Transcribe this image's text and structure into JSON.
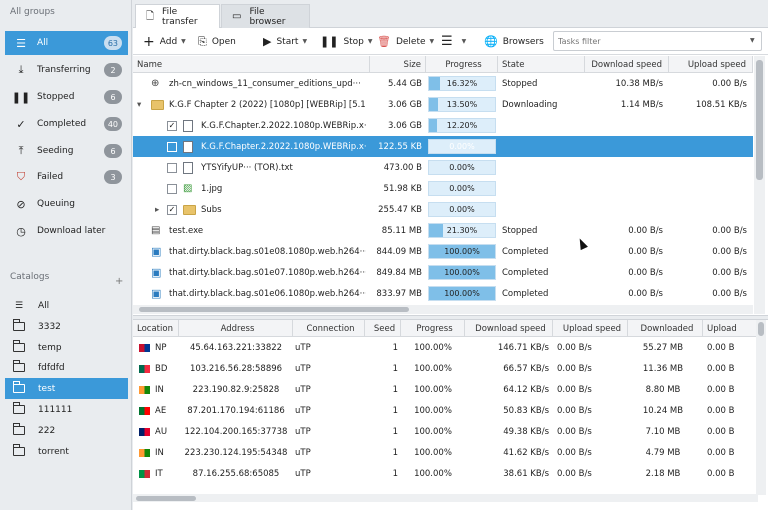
{
  "sidebar": {
    "groups_header": "All groups",
    "groups": [
      {
        "label": "All",
        "count": "63",
        "icon": "menu-lines-icon"
      },
      {
        "label": "Transferring",
        "count": "2",
        "icon": "download-arrow-icon"
      },
      {
        "label": "Stopped",
        "count": "6",
        "icon": "pause-icon"
      },
      {
        "label": "Completed",
        "count": "40",
        "icon": "checkmark-icon"
      },
      {
        "label": "Seeding",
        "count": "6",
        "icon": "upload-tray-icon"
      },
      {
        "label": "Failed",
        "count": "3",
        "icon": "shield-alert-icon"
      },
      {
        "label": "Queuing",
        "count": "",
        "icon": "compass-icon"
      },
      {
        "label": "Download later",
        "count": "",
        "icon": "clock-icon"
      }
    ],
    "catalogs_header": "Catalogs",
    "catalogs": [
      "All",
      "3332",
      "temp",
      "fdfdfd",
      "test",
      "111111",
      "222",
      "torrent"
    ]
  },
  "tabs": [
    "File transfer",
    "File browser"
  ],
  "toolbar": {
    "add": "Add",
    "open": "Open",
    "start": "Start",
    "stop": "Stop",
    "delete": "Delete",
    "browsers": "Browsers",
    "search_placeholder": "Tasks filter"
  },
  "files": {
    "columns": [
      "Name",
      "Size",
      "Progress",
      "State",
      "Download speed",
      "Upload speed"
    ],
    "rows": [
      {
        "name": "zh-cn_windows_11_consumer_editions_upd···",
        "size": "5.44 GB",
        "progress": "16.32%",
        "pct": 16.32,
        "state": "Stopped",
        "dl": "10.38 MB/s",
        "ul": "0.00 B/s",
        "icon": "globe-icon",
        "indent": 0,
        "check": "",
        "expand": "",
        "selected": false
      },
      {
        "name": "K.G.F Chapter 2 (2022) [1080p] [WEBRip] [5.1]···",
        "size": "3.06 GB",
        "progress": "13.50%",
        "pct": 13.5,
        "state": "Downloading",
        "dl": "1.14 MB/s",
        "ul": "108.51 KB/s",
        "icon": "folder-icon",
        "indent": 0,
        "check": "",
        "expand": "▾",
        "selected": false
      },
      {
        "name": "K.G.F.Chapter.2.2022.1080p.WEBRip.x···",
        "size": "3.06 GB",
        "progress": "12.20%",
        "pct": 12.2,
        "state": "",
        "dl": "",
        "ul": "",
        "icon": "video-file-icon",
        "indent": 1,
        "check": "✓",
        "expand": "",
        "selected": false
      },
      {
        "name": "K.G.F.Chapter.2.2022.1080p.WEBRip.x···",
        "size": "122.55 KB",
        "progress": "0.00%",
        "pct": 0,
        "state": "",
        "dl": "",
        "ul": "",
        "icon": "file-icon",
        "indent": 1,
        "check": "",
        "expand": "",
        "selected": true
      },
      {
        "name": "YTSYifyUP··· (TOR).txt",
        "size": "473.00 B",
        "progress": "0.00%",
        "pct": 0,
        "state": "",
        "dl": "",
        "ul": "",
        "icon": "text-file-icon",
        "indent": 1,
        "check": "",
        "expand": "",
        "selected": false
      },
      {
        "name": "1.jpg",
        "size": "51.98 KB",
        "progress": "0.00%",
        "pct": 0,
        "state": "",
        "dl": "",
        "ul": "",
        "icon": "image-file-icon",
        "indent": 1,
        "check": "",
        "expand": "",
        "selected": false
      },
      {
        "name": "Subs",
        "size": "255.47 KB",
        "progress": "0.00%",
        "pct": 0,
        "state": "",
        "dl": "",
        "ul": "",
        "icon": "folder-icon",
        "indent": 1,
        "check": "✓",
        "expand": "▸",
        "selected": false
      },
      {
        "name": "test.exe",
        "size": "85.11 MB",
        "progress": "21.30%",
        "pct": 21.3,
        "state": "Stopped",
        "dl": "0.00 B/s",
        "ul": "0.00 B/s",
        "icon": "exe-icon",
        "indent": 0,
        "check": "",
        "expand": "",
        "selected": false
      },
      {
        "name": "that.dirty.black.bag.s01e08.1080p.web.h264···",
        "size": "844.09 MB",
        "progress": "100.00%",
        "pct": 100,
        "state": "Completed",
        "dl": "0.00 B/s",
        "ul": "0.00 B/s",
        "icon": "save-icon",
        "indent": 0,
        "check": "",
        "expand": "",
        "selected": false
      },
      {
        "name": "that.dirty.black.bag.s01e07.1080p.web.h264···",
        "size": "849.84 MB",
        "progress": "100.00%",
        "pct": 100,
        "state": "Completed",
        "dl": "0.00 B/s",
        "ul": "0.00 B/s",
        "icon": "save-icon",
        "indent": 0,
        "check": "",
        "expand": "",
        "selected": false
      },
      {
        "name": "that.dirty.black.bag.s01e06.1080p.web.h264···",
        "size": "833.97 MB",
        "progress": "100.00%",
        "pct": 100,
        "state": "Completed",
        "dl": "0.00 B/s",
        "ul": "0.00 B/s",
        "icon": "save-icon",
        "indent": 0,
        "check": "",
        "expand": "",
        "selected": false
      }
    ]
  },
  "peers": {
    "columns": [
      "Location",
      "Address",
      "Connection",
      "Seed",
      "Progress",
      "Download speed",
      "Upload speed",
      "Downloaded",
      "Upload"
    ],
    "rows": [
      {
        "cc": "NP",
        "addr": "45.64.163.221:33822",
        "conn": "uTP",
        "seed": "1",
        "prog": "100.00%",
        "dl": "146.71 KB/s",
        "ul": "0.00 B/s",
        "down": "55.27 MB",
        "up": "0.00 B",
        "flag": [
          "#c8102e",
          "#003893"
        ]
      },
      {
        "cc": "BD",
        "addr": "103.216.56.28:58896",
        "conn": "uTP",
        "seed": "1",
        "prog": "100.00%",
        "dl": "66.57 KB/s",
        "ul": "0.00 B/s",
        "down": "11.36 MB",
        "up": "0.00 B",
        "flag": [
          "#006a4e",
          "#f42a41"
        ]
      },
      {
        "cc": "IN",
        "addr": "223.190.82.9:25828",
        "conn": "uTP",
        "seed": "1",
        "prog": "100.00%",
        "dl": "64.12 KB/s",
        "ul": "0.00 B/s",
        "down": "8.80 MB",
        "up": "0.00 B",
        "flag": [
          "#ff9933",
          "#138808"
        ]
      },
      {
        "cc": "AE",
        "addr": "87.201.170.194:61186",
        "conn": "uTP",
        "seed": "1",
        "prog": "100.00%",
        "dl": "50.83 KB/s",
        "ul": "0.00 B/s",
        "down": "10.24 MB",
        "up": "0.00 B",
        "flag": [
          "#00732f",
          "#ff0000"
        ]
      },
      {
        "cc": "AU",
        "addr": "122.104.200.165:37738",
        "conn": "uTP",
        "seed": "1",
        "prog": "100.00%",
        "dl": "49.38 KB/s",
        "ul": "0.00 B/s",
        "down": "7.10 MB",
        "up": "0.00 B",
        "flag": [
          "#012169",
          "#e4002b"
        ]
      },
      {
        "cc": "IN",
        "addr": "223.230.124.195:54348",
        "conn": "uTP",
        "seed": "1",
        "prog": "100.00%",
        "dl": "41.62 KB/s",
        "ul": "0.00 B/s",
        "down": "4.79 MB",
        "up": "0.00 B",
        "flag": [
          "#ff9933",
          "#138808"
        ]
      },
      {
        "cc": "IT",
        "addr": "87.16.255.68:65085",
        "conn": "uTP",
        "seed": "1",
        "prog": "100.00%",
        "dl": "38.61 KB/s",
        "ul": "0.00 B/s",
        "down": "2.18 MB",
        "up": "0.00 B",
        "flag": [
          "#009246",
          "#ce2b37"
        ]
      }
    ]
  },
  "colors": {
    "accent": "#3b99d9",
    "progress_fill": "#7fbfe8"
  }
}
